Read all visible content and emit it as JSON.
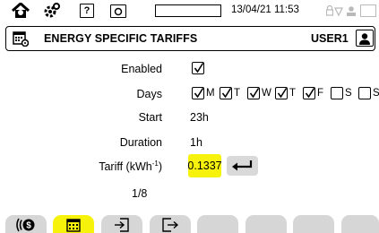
{
  "status_bar": {
    "icons": [
      "home-icon",
      "gear-icon",
      "help-icon",
      "camera-icon",
      "battery-icon",
      "lock-icon",
      "signal-icon",
      "user-icon",
      "screen-icon"
    ],
    "help_glyph": "?",
    "datetime": "13/04/21 11:53"
  },
  "header": {
    "title": "ENERGY SPECIFIC TARIFFS",
    "user": "USER1",
    "icon": "calendar-settings-icon",
    "user_button_icon": "person-icon"
  },
  "form": {
    "enabled": {
      "label": "Enabled",
      "checked": true
    },
    "days": {
      "label": "Days",
      "items": [
        {
          "letter": "M",
          "checked": true
        },
        {
          "letter": "T",
          "checked": true
        },
        {
          "letter": "W",
          "checked": true
        },
        {
          "letter": "T",
          "checked": true
        },
        {
          "letter": "F",
          "checked": true
        },
        {
          "letter": "S",
          "checked": false
        },
        {
          "letter": "S",
          "checked": false
        }
      ]
    },
    "start": {
      "label": "Start",
      "value": "23h"
    },
    "duration": {
      "label": "Duration",
      "value": "1h"
    },
    "tariff": {
      "label": "Tariff (kWh",
      "label_sup": "-1",
      "label_end": ")",
      "value": "0.1337"
    },
    "enter_icon": "enter-arrow-icon",
    "page": "1/8"
  },
  "tabs": [
    {
      "icon": "currency-icon",
      "active": false
    },
    {
      "icon": "calendar-icon",
      "active": true
    },
    {
      "icon": "import-icon",
      "active": false
    },
    {
      "icon": "export-icon",
      "active": false
    },
    {
      "icon": "",
      "active": false
    },
    {
      "icon": "",
      "active": false
    },
    {
      "icon": "",
      "active": false
    },
    {
      "icon": "",
      "active": false
    }
  ],
  "colors": {
    "highlight": "#f6f20b",
    "tab_inactive": "#d6d6d6",
    "enter_button": "#d9d9d9",
    "status_gray": "#b9b9b9"
  }
}
